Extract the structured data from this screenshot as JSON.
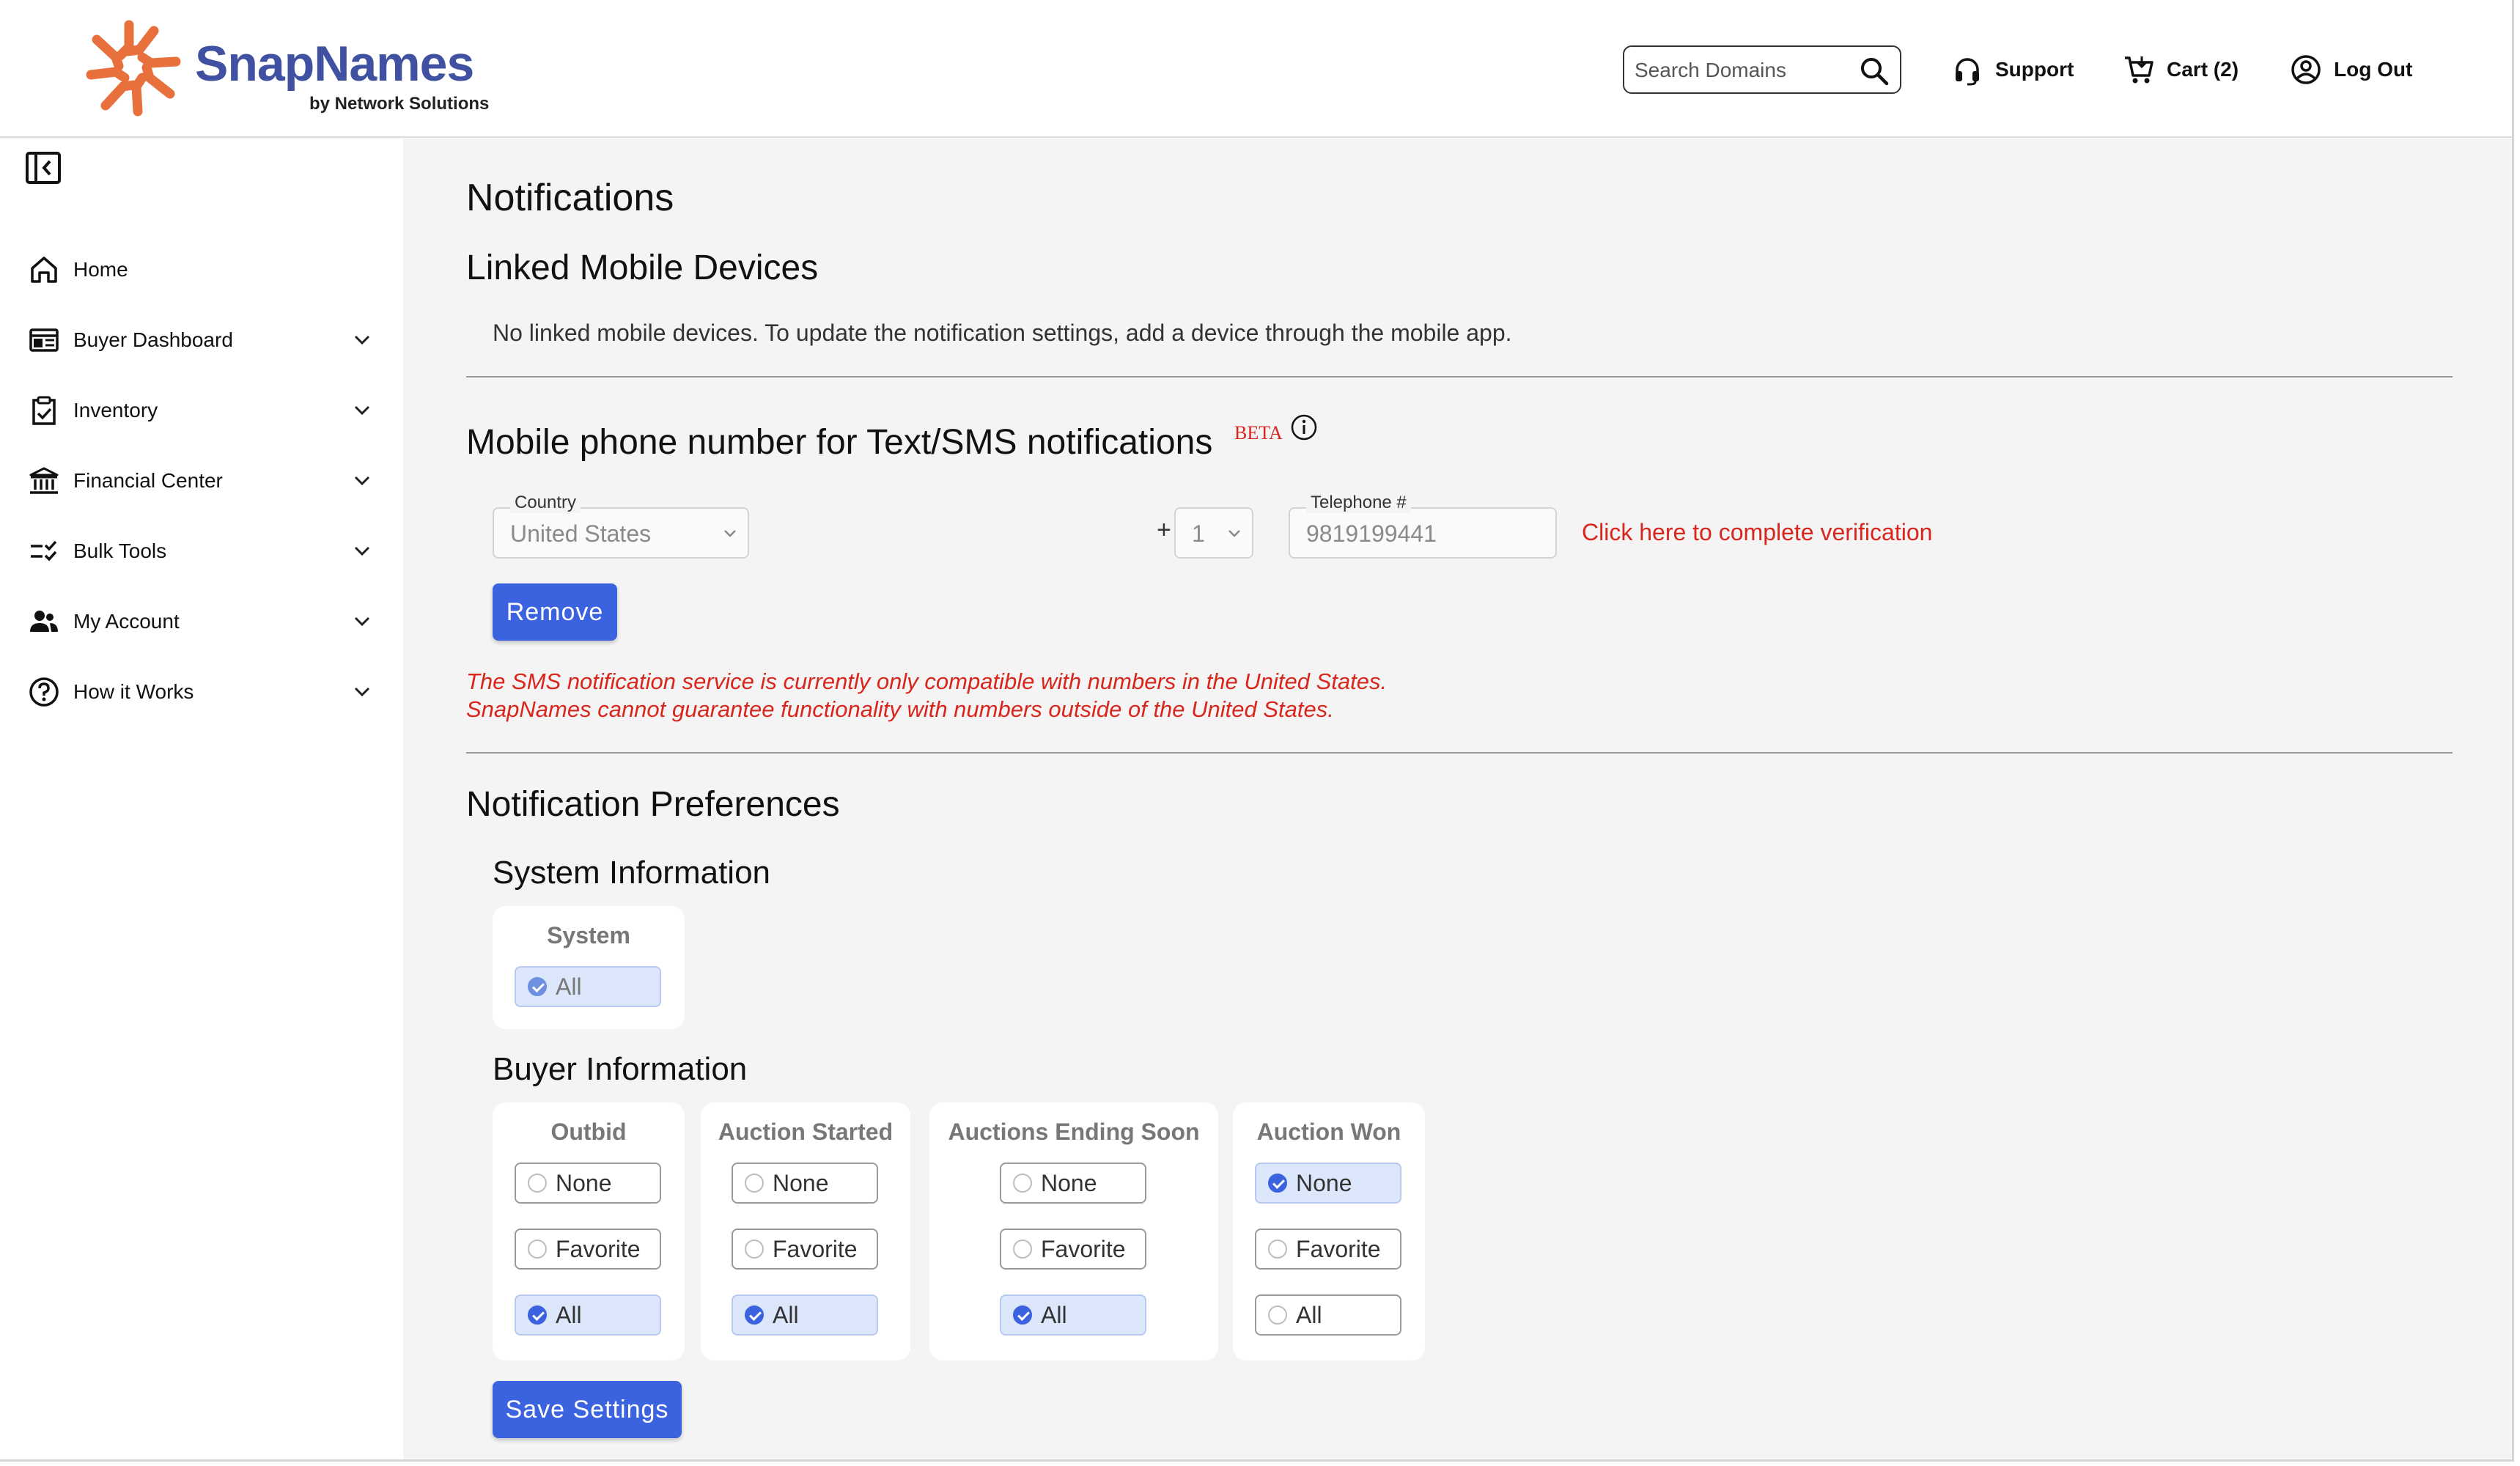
{
  "brand": {
    "name": "SnapNames",
    "tagline": "by Network Solutions",
    "primary_color": "#3f51a0",
    "logo_color": "#e8703d"
  },
  "header": {
    "search_placeholder": "Search Domains",
    "support_label": "Support",
    "cart_label": "Cart (2)",
    "logout_label": "Log Out"
  },
  "sidebar": {
    "items": [
      {
        "label": "Home",
        "icon": "home-icon"
      },
      {
        "label": "Buyer Dashboard",
        "icon": "dashboard-icon"
      },
      {
        "label": "Inventory",
        "icon": "clipboard-check-icon"
      },
      {
        "label": "Financial Center",
        "icon": "bank-icon"
      },
      {
        "label": "Bulk Tools",
        "icon": "checklist-icon"
      },
      {
        "label": "My Account",
        "icon": "users-icon"
      },
      {
        "label": "How it Works",
        "icon": "help-circle-icon"
      }
    ]
  },
  "main": {
    "title": "Notifications",
    "linked": {
      "heading": "Linked Mobile Devices",
      "message": "No linked mobile devices. To update the notification settings, add a device through the mobile app."
    },
    "sms": {
      "heading": "Mobile phone number for Text/SMS notifications",
      "beta": "BETA",
      "country_label": "Country",
      "country_value": "United States",
      "code_value": "1",
      "plus": "+",
      "phone_label": "Telephone #",
      "phone_value": "9819199441",
      "verify_link": "Click here to complete verification",
      "remove_button": "Remove",
      "warning_line1": "The SMS notification service is currently only compatible with numbers in the United States.",
      "warning_line2": "SnapNames cannot guarantee functionality with numbers outside of the United States."
    },
    "prefs": {
      "heading": "Notification Preferences",
      "system_heading": "System Information",
      "system_card": {
        "title": "System",
        "options": [
          {
            "label": "All",
            "selected": true
          }
        ]
      },
      "buyer_heading": "Buyer Information",
      "buyer_cards": [
        {
          "title": "Outbid",
          "options": [
            {
              "label": "None",
              "selected": false
            },
            {
              "label": "Favorite",
              "selected": false
            },
            {
              "label": "All",
              "selected": true
            }
          ]
        },
        {
          "title": "Auction Started",
          "options": [
            {
              "label": "None",
              "selected": false
            },
            {
              "label": "Favorite",
              "selected": false
            },
            {
              "label": "All",
              "selected": true
            }
          ]
        },
        {
          "title": "Auctions Ending Soon",
          "options": [
            {
              "label": "None",
              "selected": false
            },
            {
              "label": "Favorite",
              "selected": false
            },
            {
              "label": "All",
              "selected": true
            }
          ]
        },
        {
          "title": "Auction Won",
          "options": [
            {
              "label": "None",
              "selected": true
            },
            {
              "label": "Favorite",
              "selected": false
            },
            {
              "label": "All",
              "selected": false
            }
          ]
        }
      ],
      "save_button": "Save Settings"
    },
    "accent_color": "#3b63e0",
    "warning_color": "#d9261c"
  }
}
